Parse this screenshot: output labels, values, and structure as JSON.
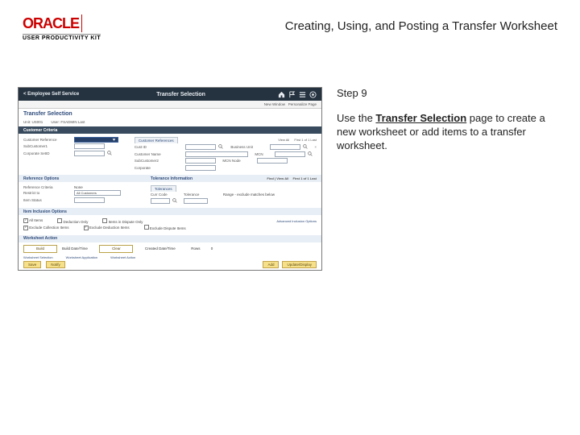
{
  "document": {
    "brand_main": "ORACLE",
    "brand_sub": "USER PRODUCTIVITY KIT",
    "title": "Creating, Using, and Posting a Transfer Worksheet",
    "step_label": "Step 9",
    "instruction_prefix": "Use the ",
    "instruction_bold": "Transfer Selection",
    "instruction_suffix": " page to create a new worksheet or add items to a transfer worksheet."
  },
  "app": {
    "topbar": {
      "back_label": "< Employee Self Service",
      "center_title": "Transfer Selection",
      "icon_home": "home-icon",
      "icon_flag": "flag-icon",
      "icon_menu": "menu-icon",
      "icon_badge": "bell-icon"
    },
    "subheader": {
      "left": "",
      "right_new": "New Window",
      "right_pers": "Personalize Page"
    },
    "page_title": "Transfer Selection",
    "id_row": {
      "unit_lbl": "Unit:",
      "unit_val": "US001",
      "user_lbl": "User:",
      "user_val": "FSADMIN    Last"
    },
    "customer_criteria": {
      "heading": "Customer Criteria",
      "cust_ref_lbl": "Customer Reference",
      "subcust1_lbl": "SubCustomer1",
      "corp_setid_lbl": "Corporate SetID",
      "cust_ref_group": "Customer References",
      "pagenav": "First   1 of 1   Last",
      "cust_id_lbl": "Cust ID",
      "cust_name_lbl": "Customer Name",
      "bunit_lbl": "Business Unit",
      "mcn_lbl": "MCN",
      "mcn_node_lbl": "MCN Node",
      "subcust2_lbl": "SubCustomer2",
      "corp_cust_lbl": "Corporate",
      "viewall": "View All",
      "close_x": "×"
    },
    "reference_options": {
      "heading": "Reference Options",
      "ref_criteria_lbl": "Reference Criteria",
      "none_val": "None",
      "restrict_lbl": "Restrict to",
      "all_cust_val": "All Customers",
      "item_status_lbl": "Item Status"
    },
    "tolerance": {
      "heading": "Tolerance Information",
      "tab_label": "Tolerances",
      "currcode_lbl": "Curr Code",
      "tolerance_lbl": "Tolerance",
      "find": "Find | View All",
      "pagenav": "First   1 of 1   Last",
      "range_lbl": "Range - exclude matches below"
    },
    "item_inclusion": {
      "heading": "Item Inclusion Options",
      "all_items": "All Items",
      "ded_only": "Deduction Only",
      "items_dispute": "Items in Dispute Only",
      "exclude_coll": "Exclude Collection Items",
      "exclude_ded": "Exclude Deduction Items",
      "exclude_disp": "Exclude Dispute Items",
      "adv_link": "Advanced Inclusion Options"
    },
    "worksheet_action": {
      "heading": "Worksheet Action",
      "build_btn": "Build",
      "build_dt_lbl": "Build Date/Time",
      "clear_btn": "Clear",
      "created_dt_lbl": "Created Date/Time",
      "rows_lbl": "Rows",
      "rows_val": "0",
      "ws_sel_link": "Worksheet Selection",
      "ws_app_link": "Worksheet Application",
      "ws_action_link": "Worksheet Action"
    },
    "footer": {
      "save": "Save",
      "notify": "Notify",
      "add": "Add",
      "update": "Update/Display"
    }
  }
}
